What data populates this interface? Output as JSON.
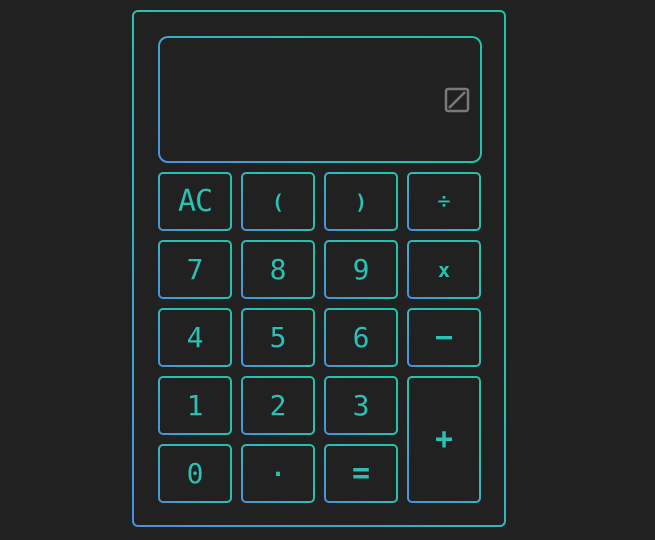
{
  "display": {
    "value": "",
    "icon": "zero-icon"
  },
  "keys": {
    "ac": "AC",
    "open_paren": "(",
    "close_paren": ")",
    "divide": "÷",
    "seven": "7",
    "eight": "8",
    "nine": "9",
    "multiply": "x",
    "four": "4",
    "five": "5",
    "six": "6",
    "minus": "−",
    "one": "1",
    "two": "2",
    "three": "3",
    "plus": "+",
    "zero": "0",
    "dot": "·",
    "equals": "="
  },
  "colors": {
    "background": "#212121",
    "accent": "#2bc0b4",
    "border_blue": "#4a90e2",
    "border_teal": "#1ec3a8",
    "icon_gray": "#7a7a7a"
  }
}
